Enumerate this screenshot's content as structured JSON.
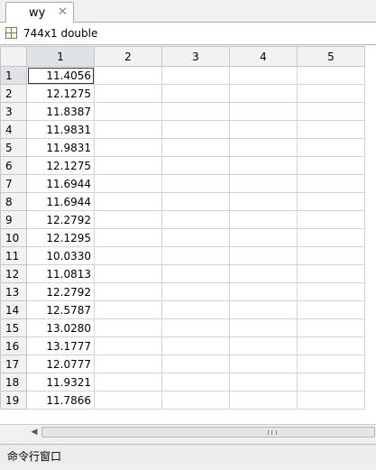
{
  "tab": {
    "label": "wy",
    "close_glyph": "✕"
  },
  "variable": {
    "size_label": "744x1 double",
    "icon": "variable-grid-icon"
  },
  "grid": {
    "columns": [
      "1",
      "2",
      "3",
      "4",
      "5"
    ],
    "rows": [
      {
        "index": "1",
        "value": "11.4056"
      },
      {
        "index": "2",
        "value": "12.1275"
      },
      {
        "index": "3",
        "value": "11.8387"
      },
      {
        "index": "4",
        "value": "11.9831"
      },
      {
        "index": "5",
        "value": "11.9831"
      },
      {
        "index": "6",
        "value": "12.1275"
      },
      {
        "index": "7",
        "value": "11.6944"
      },
      {
        "index": "8",
        "value": "11.6944"
      },
      {
        "index": "9",
        "value": "12.2792"
      },
      {
        "index": "10",
        "value": "12.1295"
      },
      {
        "index": "11",
        "value": "10.0330"
      },
      {
        "index": "12",
        "value": "11.0813"
      },
      {
        "index": "13",
        "value": "12.2792"
      },
      {
        "index": "14",
        "value": "12.5787"
      },
      {
        "index": "15",
        "value": "13.0280"
      },
      {
        "index": "16",
        "value": "13.1777"
      },
      {
        "index": "17",
        "value": "12.0777"
      },
      {
        "index": "18",
        "value": "11.9321"
      },
      {
        "index": "19",
        "value": "11.7866"
      }
    ]
  },
  "scrollbar": {
    "left_arrow": "◀"
  },
  "command_window": {
    "label": "命令行窗口"
  }
}
